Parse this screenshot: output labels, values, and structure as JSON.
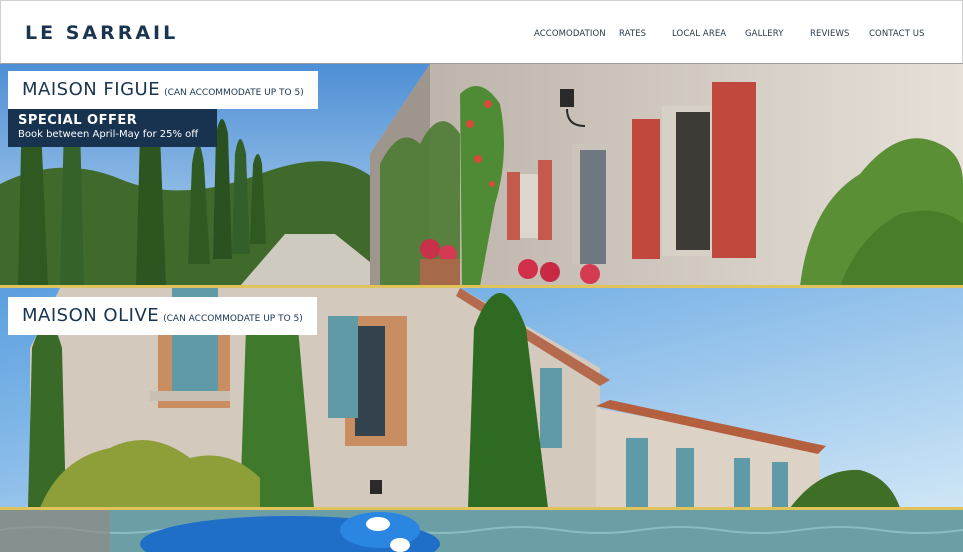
{
  "header": {
    "logo": "LE SARRAIL",
    "nav": [
      "ACCOMODATION",
      "RATES",
      "LOCAL AREA",
      "GALLERY",
      "REVIEWS",
      "CONTACT US"
    ]
  },
  "properties": [
    {
      "name": "MAISON FIGUE",
      "capacity": "(CAN ACCOMMODATE UP TO 5)",
      "offer": {
        "title": "SPECIAL OFFER",
        "text": "Book between April-May for 25% off"
      }
    },
    {
      "name": "MAISON OLIVE",
      "capacity": "(CAN ACCOMMODATE UP TO 5)"
    }
  ],
  "colors": {
    "brand_navy": "#1a3550",
    "divider_gold": "#e0c35a",
    "offer_bg": "#173350"
  }
}
